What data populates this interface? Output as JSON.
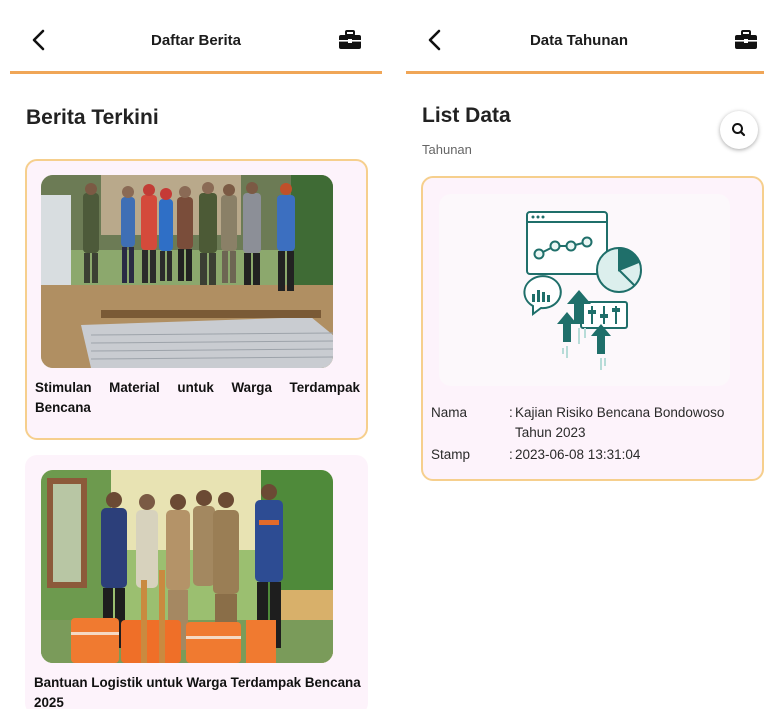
{
  "left": {
    "appbar": {
      "title": "Daftar Berita"
    },
    "heading": "Berita Terkini",
    "news": [
      {
        "caption": "Stimulan Material untuk Warga Terdampak Bencana"
      },
      {
        "caption": "Bantuan Logistik untuk Warga Terdampak Bencana 2025"
      }
    ]
  },
  "right": {
    "appbar": {
      "title": "Data Tahunan"
    },
    "heading": "List Data",
    "subheading": "Tahunan",
    "item": {
      "name_label": "Nama",
      "name_value": "Kajian Risiko Bencana Bondowoso Tahun 2023",
      "stamp_label": "Stamp",
      "stamp_value": "2023-06-08 13:31:04",
      "separator": ":"
    }
  },
  "colors": {
    "accent": "#f0a657",
    "card_bg": "#fdf3fb",
    "card_border": "#f6cf8d",
    "teal": "#1f6f6a"
  }
}
